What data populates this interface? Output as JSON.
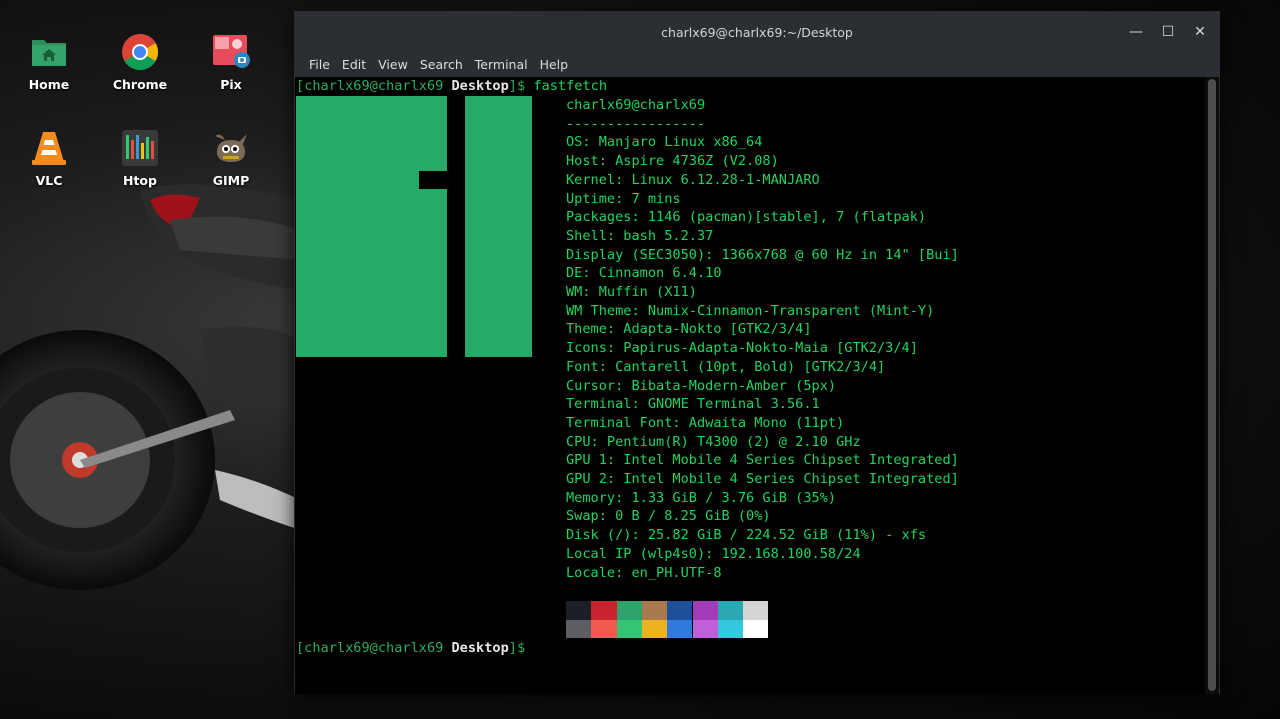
{
  "desktop": {
    "icons": [
      {
        "label": "Home",
        "icon": "home-folder-icon"
      },
      {
        "label": "Chrome",
        "icon": "chrome-icon"
      },
      {
        "label": "Pix",
        "icon": "pix-icon"
      },
      {
        "label": "VLC",
        "icon": "vlc-icon"
      },
      {
        "label": "Htop",
        "icon": "htop-icon"
      },
      {
        "label": "GIMP",
        "icon": "gimp-icon"
      }
    ]
  },
  "window": {
    "title": "charlx69@charlx69:~/Desktop",
    "controls": {
      "minimize": "—",
      "maximize": "☐",
      "close": "✕"
    },
    "menu": [
      "File",
      "Edit",
      "View",
      "Search",
      "Terminal",
      "Help"
    ]
  },
  "terminal": {
    "prompt_user": "[charlx69@charlx69 ",
    "prompt_dir": "Desktop",
    "prompt_end": "]$",
    "command": " fastfetch",
    "header": "charlx69@charlx69",
    "separator": "-----------------",
    "info": [
      "OS: Manjaro Linux x86_64",
      "Host: Aspire 4736Z (V2.08)",
      "Kernel: Linux 6.12.28-1-MANJARO",
      "Uptime: 7 mins",
      "Packages: 1146 (pacman)[stable], 7 (flatpak)",
      "Shell: bash 5.2.37",
      "Display (SEC3050): 1366x768 @ 60 Hz in 14\" [Bui]",
      "DE: Cinnamon 6.4.10",
      "WM: Muffin (X11)",
      "WM Theme: Numix-Cinnamon-Transparent (Mint-Y)",
      "Theme: Adapta-Nokto [GTK2/3/4]",
      "Icons: Papirus-Adapta-Nokto-Maia [GTK2/3/4]",
      "Font: Cantarell (10pt, Bold) [GTK2/3/4]",
      "Cursor: Bibata-Modern-Amber (5px)",
      "Terminal: GNOME Terminal 3.56.1",
      "Terminal Font: Adwaita Mono (11pt)",
      "CPU: Pentium(R) T4300 (2) @ 2.10 GHz",
      "GPU 1: Intel Mobile 4 Series Chipset Integrated]",
      "GPU 2: Intel Mobile 4 Series Chipset Integrated]",
      "Memory: 1.33 GiB / 3.76 GiB (35%)",
      "Swap: 0 B / 8.25 GiB (0%)",
      "Disk (/): 25.82 GiB / 224.52 GiB (11%) - xfs",
      "Local IP (wlp4s0): 192.168.100.58/24",
      "Locale: en_PH.UTF-8"
    ],
    "palette_top": [
      "#1c1f26",
      "#c9232f",
      "#2ea36b",
      "#a97a4e",
      "#1d4f9a",
      "#a23cb8",
      "#2ca7b4",
      "#d4d4d4"
    ],
    "palette_bottom": [
      "#5c5e63",
      "#f15a4e",
      "#33c573",
      "#ecb220",
      "#2f7be0",
      "#c05fd8",
      "#33c8db",
      "#ffffff"
    ],
    "logo_color": "#27a968"
  }
}
